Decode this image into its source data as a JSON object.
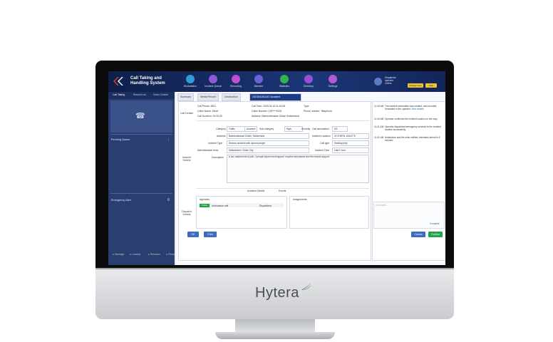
{
  "brand": {
    "name": "Hytera"
  },
  "app": {
    "title_line1": "Call Taking and",
    "title_line2": "Handling System",
    "colors": {
      "header": "#1c3677",
      "sidebar": "#2a3e72",
      "accent_yellow": "#f1c232",
      "accent_green": "#21a34a",
      "primary": "#3e6bc2"
    }
  },
  "nav": [
    {
      "label": "Workstation",
      "icon": "workstation-icon",
      "color": "#2f9bd8"
    },
    {
      "label": "Incident Queue",
      "icon": "queue-icon",
      "color": "#8e5ad8"
    },
    {
      "label": "Recording",
      "icon": "recording-icon",
      "color": "#c04fd0"
    },
    {
      "label": "Member",
      "icon": "member-icon",
      "color": "#6a62d8"
    },
    {
      "label": "Statistics",
      "icon": "statistics-icon",
      "color": "#33b34a"
    },
    {
      "label": "Directory",
      "icon": "directory-icon",
      "color": "#9650d4"
    },
    {
      "label": "Settings",
      "icon": "settings-icon",
      "color": "#b25ad4"
    }
  ],
  "user": {
    "line1": "Dispatcher",
    "line2": "operator",
    "line3": "Online",
    "btn1": "Change User",
    "btn2": "Help"
  },
  "left": {
    "tabs": [
      "Call Taking",
      "Record List",
      "Voice Control"
    ],
    "panels": [
      {
        "label": "Pending Queue"
      },
      {
        "label": "Emergency Alert",
        "count": "0"
      }
    ],
    "footer": [
      "Message",
      "Location",
      "Resource",
      "Phone"
    ]
  },
  "tabs": [
    "Summary",
    "Media Record",
    "Geolocation",
    "2023041811401 Accident"
  ],
  "form": {
    "call_details_label": "Call Details",
    "call_phone": "Call Phone: 4501",
    "call_time": "Call Time: 2023-04-18 11:40:25",
    "call_type": "Type",
    "caller_name": "Caller Name: Steve",
    "caller_number": "Caller Number: 139****1000",
    "phone_number_label": "Phone number: Telephone",
    "call_duration": "Call Duration: 00:00:30",
    "address_line": "Address: Bahnhofstrasse Zürich Switzerland",
    "incident_label": "Incident Details",
    "category_label": "Category",
    "category_val": "Traffic",
    "sub_category_label": "Sub-category",
    "sub_category_val": "Accident",
    "severity_label": "Severity",
    "severity_val": "High",
    "call_association_label": "Call association",
    "call_association_val": "0/3",
    "address_label": "Address",
    "address_val": "Bahnhofstrasse Zürich, Switzerland",
    "latitude_label": "Incident Location",
    "latitude_val": "47.3769°N, 8.5417°E",
    "incident_type_label": "Incident Type",
    "incident_type_val": "Serious accident with injured people",
    "call_type_label": "Call type",
    "call_type_val": "Seeking help",
    "admin_area_label": "Administrative Area",
    "admin_area_val": "Switzerland / Zürich City",
    "reported_label": "Incident Time",
    "reported_val": "Last 1 hour",
    "description_label": "Description",
    "description_val": "A car crashed into a pole; 2 people injured and trapped; requires ambulance and fire rescue support.",
    "section_toggle_1": "Accident Details",
    "section_toggle_2": "Events",
    "dispatch_label": "Dispatch Details",
    "units_header": "Agencies",
    "units_item_tag": "Police",
    "units_item_name": "Ambulance unit",
    "units_item_status": "Dispatched",
    "assignments_header": "Assignments",
    "btn_ok": "OK",
    "btn_print": "Print"
  },
  "right": {
    "entries": [
      {
        "time": "11:40 AM",
        "text": "The incident information was created; call recorded; forwarded to the operator.",
        "link": "View details"
      },
      {
        "time": "11:40 AM",
        "text": "Operator confirmed the incident location on the map."
      },
      {
        "time": "11:41 AM",
        "text": "Operator dispatched emergency services to the incident location successfully."
      },
      {
        "time": "11:41 AM",
        "text": "Ambulance and fire units notified; estimated arrival in 6 minutes."
      }
    ],
    "note_placeholder": "Add notes...",
    "complete_link": "Complete",
    "btn_cancel": "Cancel",
    "btn_confirm": "Confirm"
  }
}
